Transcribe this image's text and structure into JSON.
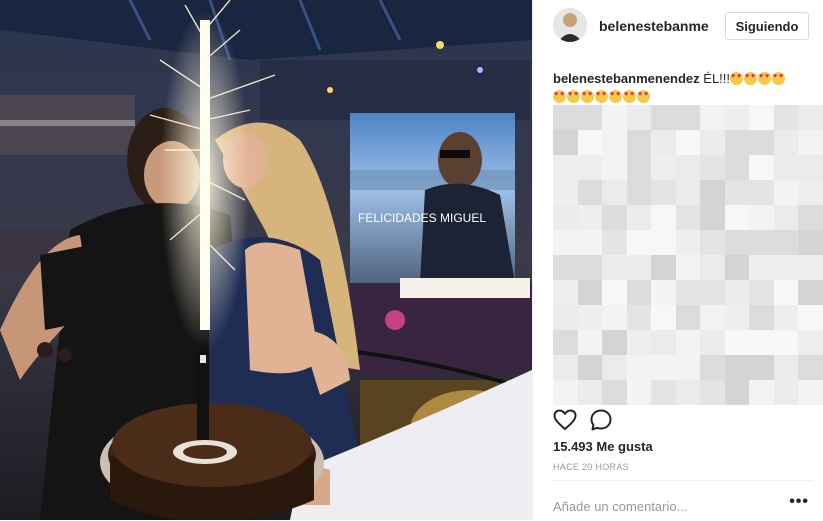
{
  "post": {
    "username": "belenestebanmenendez",
    "follow_label": "Siguiendo",
    "caption_user": "belenestebanmenendez",
    "caption_text": " ÉL!!!",
    "likes": "15.493 Me gusta",
    "time": "HACE 20 HORAS",
    "comment_placeholder": "Añade un comentario...",
    "more_label": "•••"
  },
  "photo": {
    "screen_text": "FELICIDADES MIGUEL"
  },
  "icons": {
    "like": "heart-outline-icon",
    "comment": "speech-bubble-icon",
    "more": "ellipsis-icon"
  },
  "colors": {
    "username": "#262626",
    "meta": "#999999",
    "border": "#dbdbdb"
  }
}
